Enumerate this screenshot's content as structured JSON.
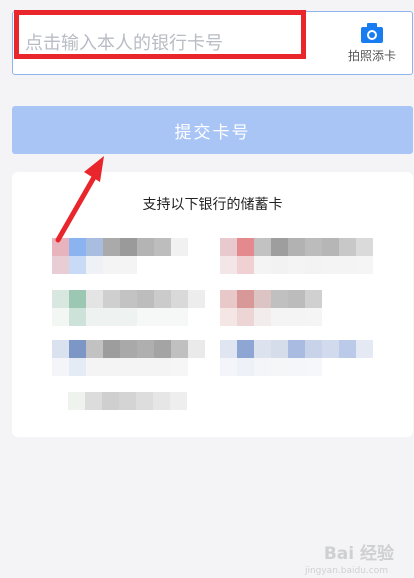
{
  "card_input": {
    "placeholder": "点击输入本人的银行卡号",
    "photo_label": "拍照添卡",
    "accent_color": "#1a7cf1",
    "border_color": "#8fb4ee"
  },
  "submit": {
    "label": "提交卡号",
    "bg_color": "#a9c5f6"
  },
  "banks": {
    "title": "支持以下银行的储蓄卡",
    "count_rows": 4
  },
  "watermark": {
    "text": "Bai 经验",
    "sub": "jingyan.baidu.com"
  }
}
